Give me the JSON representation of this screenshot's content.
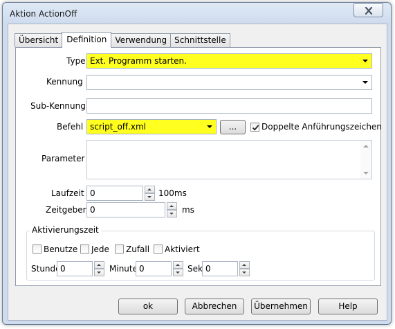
{
  "window": {
    "title": "Aktion ActionOff",
    "close_glyph": "x"
  },
  "tabs": [
    {
      "label": "Übersicht",
      "active": false
    },
    {
      "label": "Definition",
      "active": true
    },
    {
      "label": "Verwendung",
      "active": false
    },
    {
      "label": "Schnittstelle",
      "active": false
    }
  ],
  "form": {
    "type_label": "Type",
    "type_value": "Ext. Programm starten.",
    "kennung_label": "Kennung",
    "kennung_value": "",
    "subkennung_label": "Sub-Kennung",
    "subkennung_value": "",
    "befehl_label": "Befehl",
    "befehl_value": "script_off.xml",
    "browse_label": "...",
    "quotes_label": "Doppelte Anführungszeichen",
    "quotes_checked": true,
    "parameter_label": "Parameter",
    "parameter_value": "",
    "laufzeit_label": "Laufzeit",
    "laufzeit_value": "0",
    "laufzeit_unit": "100ms",
    "zeitgeber_label": "Zeitgeber",
    "zeitgeber_value": "0",
    "zeitgeber_unit": "ms"
  },
  "activation": {
    "group_title": "Aktivierungszeit",
    "checkboxes": [
      {
        "label": "Benutze",
        "checked": false
      },
      {
        "label": "Jede",
        "checked": false
      },
      {
        "label": "Zufall",
        "checked": false
      },
      {
        "label": "Aktiviert",
        "checked": false
      }
    ],
    "stunde_label": "Stunde",
    "stunde_value": "0",
    "minute_label": "Minute",
    "minute_value": "0",
    "sek_label": "Sek.",
    "sek_value": "0"
  },
  "buttons": {
    "ok": "ok",
    "cancel": "Abbrechen",
    "apply": "Übernehmen",
    "help": "Help"
  },
  "colors": {
    "highlight": "#ffff20",
    "window_frame": "#cfdcee"
  }
}
